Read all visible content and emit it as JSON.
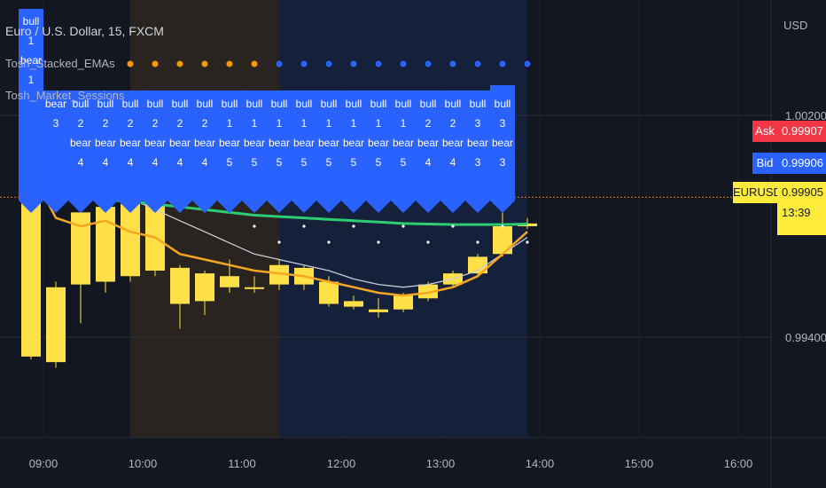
{
  "header": {
    "symbol_line": "Euro / U.S. Dollar, 15, FXCM",
    "indicator_1": "Tosh_Stacked_EMAs",
    "indicator_2": "Tosh_Market_Sessions"
  },
  "price_scale": {
    "currency": "USD",
    "ask_label": "Ask",
    "ask_value": "0.99907",
    "bid_label": "Bid",
    "bid_value": "0.99906",
    "symbol_label": "EURUSD",
    "last_value": "0.99905",
    "countdown": "13:39"
  },
  "colors": {
    "background": "#131722",
    "bull_candle": "#ffe046",
    "ema_fast": "#f5a623",
    "ema_slow": "#2ecc71",
    "ema_mid": "#c9ccd4",
    "label_blue": "#2962ff",
    "session_asia": "#2a2420",
    "session_ny": "#15203a",
    "session_dots_orange": "#ff9800",
    "session_dots_blue": "#2962ff",
    "last_price_line": "#f57c00"
  },
  "chart_data": {
    "type": "candlestick",
    "title": "Euro / U.S. Dollar, 15, FXCM",
    "timeframe": "15",
    "x_ticks": [
      "09:00",
      "10:00",
      "11:00",
      "12:00",
      "13:00",
      "14:00",
      "15:00",
      "16:00"
    ],
    "y_ticks": [
      "1.00200",
      "0.99400"
    ],
    "y_unit": "USD",
    "last_price": 0.99905,
    "candles": [
      {
        "t": "08:45",
        "o": 1.0015,
        "h": 1.0018,
        "l": 0.9932,
        "c": 0.9933
      },
      {
        "t": "09:00",
        "o": 0.9931,
        "h": 0.996,
        "l": 0.9929,
        "c": 0.9958
      },
      {
        "t": "09:15",
        "o": 0.9959,
        "h": 0.998,
        "l": 0.9945,
        "c": 0.9985
      },
      {
        "t": "09:30",
        "o": 0.9987,
        "h": 0.9989,
        "l": 0.9956,
        "c": 0.996
      },
      {
        "t": "09:45",
        "o": 0.9962,
        "h": 0.999,
        "l": 0.996,
        "c": 0.9988
      },
      {
        "t": "10:00",
        "o": 0.9988,
        "h": 0.999,
        "l": 0.9962,
        "c": 0.9964
      },
      {
        "t": "10:15",
        "o": 0.9965,
        "h": 0.9966,
        "l": 0.9943,
        "c": 0.9952
      },
      {
        "t": "10:30",
        "o": 0.9953,
        "h": 0.9964,
        "l": 0.9948,
        "c": 0.9963
      },
      {
        "t": "10:45",
        "o": 0.9962,
        "h": 0.9968,
        "l": 0.9956,
        "c": 0.9958
      },
      {
        "t": "11:00",
        "o": 0.9958,
        "h": 0.9962,
        "l": 0.9956,
        "c": 0.9958
      },
      {
        "t": "11:15",
        "o": 0.9959,
        "h": 0.9968,
        "l": 0.9957,
        "c": 0.9966
      },
      {
        "t": "11:30",
        "o": 0.9965,
        "h": 0.9966,
        "l": 0.9957,
        "c": 0.9959
      },
      {
        "t": "11:45",
        "o": 0.996,
        "h": 0.9962,
        "l": 0.9951,
        "c": 0.9952
      },
      {
        "t": "12:00",
        "o": 0.9953,
        "h": 0.9955,
        "l": 0.995,
        "c": 0.9951
      },
      {
        "t": "12:15",
        "o": 0.995,
        "h": 0.9954,
        "l": 0.9947,
        "c": 0.9949
      },
      {
        "t": "12:30",
        "o": 0.995,
        "h": 0.9956,
        "l": 0.9949,
        "c": 0.9955
      },
      {
        "t": "12:45",
        "o": 0.9954,
        "h": 0.996,
        "l": 0.9953,
        "c": 0.9959
      },
      {
        "t": "13:00",
        "o": 0.9959,
        "h": 0.9964,
        "l": 0.9958,
        "c": 0.9963
      },
      {
        "t": "13:15",
        "o": 0.9963,
        "h": 0.997,
        "l": 0.9962,
        "c": 0.9969
      },
      {
        "t": "13:30",
        "o": 0.997,
        "h": 0.9992,
        "l": 0.9969,
        "c": 0.998
      },
      {
        "t": "13:45",
        "o": 0.998,
        "h": 0.9983,
        "l": 0.9979,
        "c": 0.9981
      }
    ],
    "stack_labels": [
      {
        "t": "08:45",
        "bull": "1",
        "bear": "1"
      },
      {
        "t": "09:00",
        "bull": "",
        "bear": "3"
      },
      {
        "t": "09:15",
        "bull": "2",
        "bear": "4"
      },
      {
        "t": "09:30",
        "bull": "2",
        "bear": "4"
      },
      {
        "t": "09:45",
        "bull": "2",
        "bear": "4"
      },
      {
        "t": "10:00",
        "bull": "2",
        "bear": "4"
      },
      {
        "t": "10:15",
        "bull": "2",
        "bear": "4"
      },
      {
        "t": "10:30",
        "bull": "2",
        "bear": "4"
      },
      {
        "t": "10:45",
        "bull": "1",
        "bear": "5"
      },
      {
        "t": "11:00",
        "bull": "1",
        "bear": "5"
      },
      {
        "t": "11:15",
        "bull": "1",
        "bear": "5"
      },
      {
        "t": "11:30",
        "bull": "1",
        "bear": "5"
      },
      {
        "t": "11:45",
        "bull": "1",
        "bear": "5"
      },
      {
        "t": "12:00",
        "bull": "1",
        "bear": "5"
      },
      {
        "t": "12:15",
        "bull": "1",
        "bear": "5"
      },
      {
        "t": "12:30",
        "bull": "1",
        "bear": "5"
      },
      {
        "t": "12:45",
        "bull": "2",
        "bear": "4"
      },
      {
        "t": "13:00",
        "bull": "2",
        "bear": "4"
      },
      {
        "t": "13:15",
        "bull": "3",
        "bear": "3"
      },
      {
        "t": "13:30",
        "bull": "3",
        "bear": "3"
      }
    ],
    "ema_fast": [
      1.0,
      0.9983,
      0.998,
      0.9982,
      0.9978,
      0.9976,
      0.997,
      0.9968,
      0.9966,
      0.9964,
      0.9963,
      0.9962,
      0.996,
      0.9958,
      0.9956,
      0.9955,
      0.9956,
      0.9958,
      0.9962,
      0.997,
      0.9978
    ],
    "ema_mid": [
      1.0002,
      0.9998,
      0.9996,
      0.9994,
      0.999,
      0.9986,
      0.9982,
      0.9978,
      0.9974,
      0.997,
      0.9968,
      0.9966,
      0.9964,
      0.9961,
      0.9959,
      0.9958,
      0.9959,
      0.9961,
      0.9964,
      0.997,
      0.9976
    ],
    "ema_slow": [
      0.9992,
      0.9991,
      0.999,
      0.99895,
      0.9989,
      0.9988,
      0.9987,
      0.9986,
      0.9985,
      0.9984,
      0.99835,
      0.9983,
      0.99825,
      0.9982,
      0.99815,
      0.9981,
      0.99808,
      0.99806,
      0.99806,
      0.99806,
      0.99808
    ],
    "sessions": [
      {
        "from": "09:45",
        "to": "11:15",
        "color_key": "session_asia"
      },
      {
        "from": "11:15",
        "to": "13:45",
        "color_key": "session_ny"
      }
    ]
  }
}
